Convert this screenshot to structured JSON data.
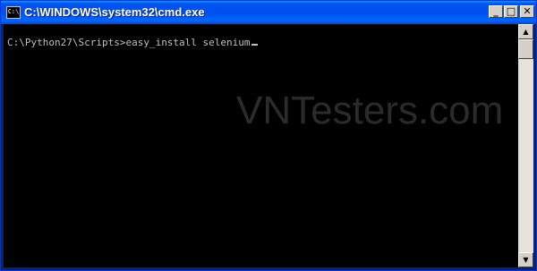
{
  "window": {
    "title": "C:\\WINDOWS\\system32\\cmd.exe",
    "icon": "cmd-icon",
    "controls": {
      "minimize": "_",
      "maximize": "□",
      "close": "✕"
    }
  },
  "console": {
    "prompt": "C:\\Python27\\Scripts>",
    "command": "easy_install selenium"
  },
  "watermark": {
    "text": "VNTesters.com"
  },
  "scrollbar": {
    "up_arrow": "▲",
    "down_arrow": "▼"
  },
  "colors": {
    "titlebar": "#0054e3",
    "console_bg": "#000000",
    "console_text": "#c0c0c0"
  }
}
